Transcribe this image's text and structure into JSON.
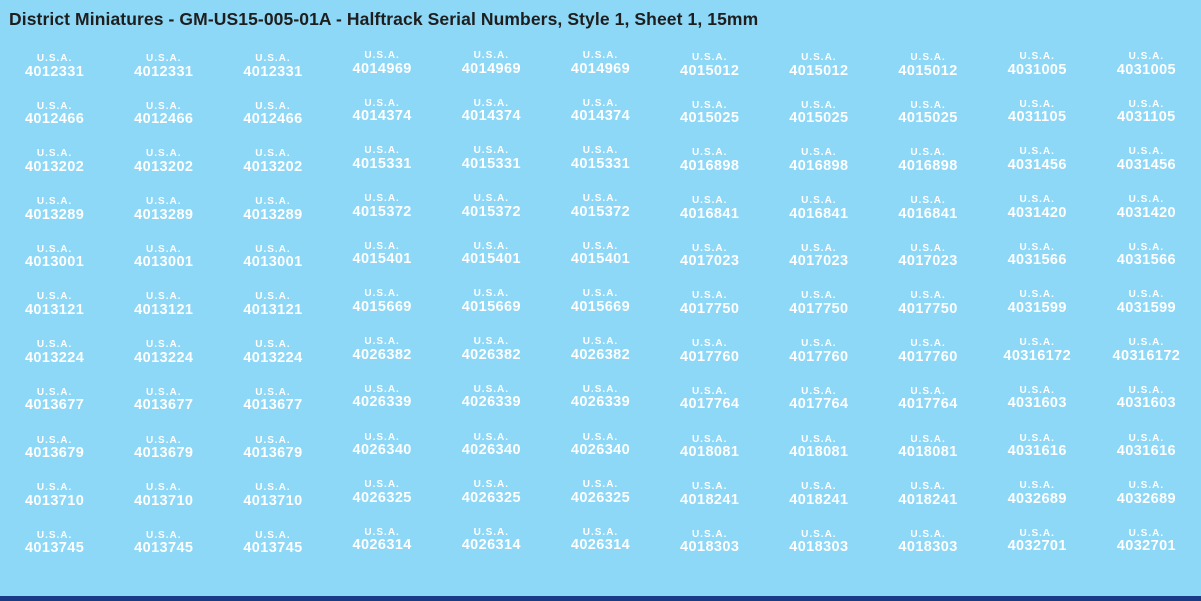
{
  "title": "District Miniatures - GM-US15-005-01A - Halftrack Serial Numbers, Style 1, Sheet 1, 15mm",
  "colors": {
    "background": "#8DD7F7",
    "title_text": "#1E1E1E",
    "decal_text": "#FFFFFF",
    "bottom_bar": "#1B3A86"
  },
  "grid": {
    "columns": 11,
    "stencil_label": "U.S.A.",
    "repeat_counts": [
      3,
      3,
      3,
      2
    ],
    "rows": [
      {
        "serials": [
          "4012331",
          "4014969",
          "4015012",
          "4031005"
        ]
      },
      {
        "serials": [
          "4012466",
          "4014374",
          "4015025",
          "4031105"
        ]
      },
      {
        "serials": [
          "4013202",
          "4015331",
          "4016898",
          "4031456"
        ]
      },
      {
        "serials": [
          "4013289",
          "4015372",
          "4016841",
          "4031420"
        ]
      },
      {
        "serials": [
          "4013001",
          "4015401",
          "4017023",
          "4031566"
        ]
      },
      {
        "serials": [
          "4013121",
          "4015669",
          "4017750",
          "4031599"
        ]
      },
      {
        "serials": [
          "4013224",
          "4026382",
          "4017760",
          "40316172"
        ]
      },
      {
        "serials": [
          "4013677",
          "4026339",
          "4017764",
          "4031603"
        ]
      },
      {
        "serials": [
          "4013679",
          "4026340",
          "4018081",
          "4031616"
        ]
      },
      {
        "serials": [
          "4013710",
          "4026325",
          "4018241",
          "4032689"
        ]
      },
      {
        "serials": [
          "4013745",
          "4026314",
          "4018303",
          "4032701"
        ]
      }
    ]
  }
}
